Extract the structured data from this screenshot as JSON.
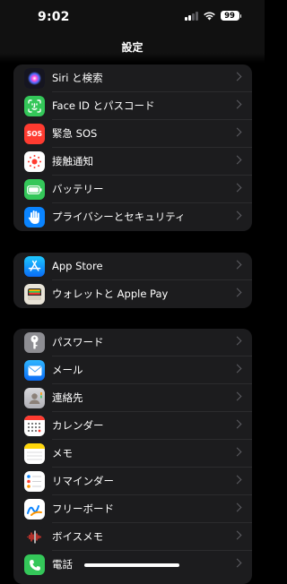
{
  "status_bar": {
    "time": "9:02",
    "battery": "99"
  },
  "nav": {
    "title": "設定"
  },
  "groups": [
    {
      "items": [
        {
          "label": "Siri と検索",
          "icon": "siri-icon"
        },
        {
          "label": "Face ID とパスコード",
          "icon": "faceid-icon",
          "color": "#34c759"
        },
        {
          "label": "緊急 SOS",
          "icon": "sos-icon",
          "icon_text": "SOS",
          "color": "#ff3b30"
        },
        {
          "label": "接触通知",
          "icon": "exposure-icon",
          "color": "#ffffff"
        },
        {
          "label": "バッテリー",
          "icon": "battery-icon",
          "color": "#34c759"
        },
        {
          "label": "プライバシーとセキュリティ",
          "icon": "hand-icon",
          "color": "#0a84ff"
        }
      ]
    },
    {
      "items": [
        {
          "label": "App Store",
          "icon": "appstore-icon",
          "color": "#0a84ff"
        },
        {
          "label": "ウォレットと Apple Pay",
          "icon": "wallet-icon",
          "color": "#2c2c2e"
        }
      ]
    },
    {
      "items": [
        {
          "label": "パスワード",
          "icon": "key-icon",
          "color": "#8e8e93"
        },
        {
          "label": "メール",
          "icon": "mail-icon",
          "color": "#0a84ff"
        },
        {
          "label": "連絡先",
          "icon": "contacts-icon",
          "color": "#8e8e93"
        },
        {
          "label": "カレンダー",
          "icon": "calendar-icon",
          "color": "#ffffff"
        },
        {
          "label": "メモ",
          "icon": "notes-icon",
          "color": "#ffffff"
        },
        {
          "label": "リマインダー",
          "icon": "reminders-icon",
          "color": "#ffffff"
        },
        {
          "label": "フリーボード",
          "icon": "freeform-icon",
          "color": "#ffffff"
        },
        {
          "label": "ボイスメモ",
          "icon": "voice-memos-icon",
          "color": "#1c1c1e"
        },
        {
          "label": "電話",
          "icon": "phone-icon",
          "color": "#34c759"
        }
      ]
    }
  ]
}
